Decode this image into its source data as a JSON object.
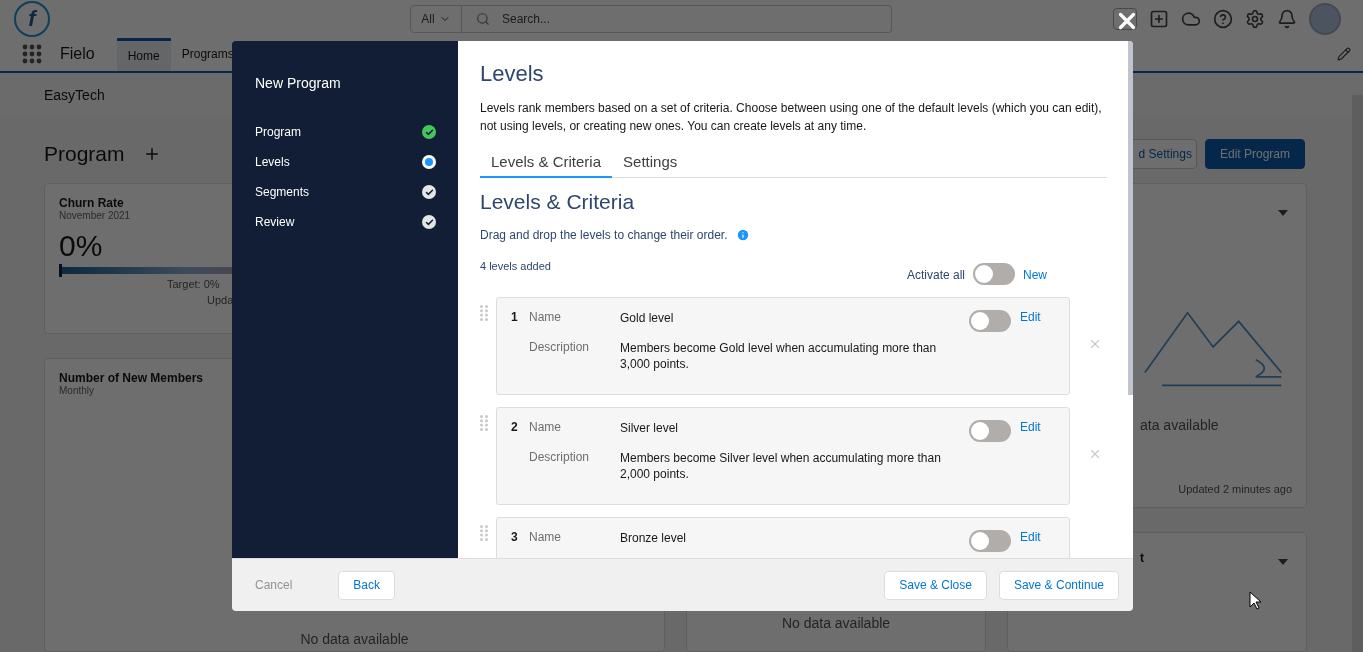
{
  "header": {
    "logo_text": "f",
    "search_scope": "All",
    "search_placeholder": "Search..."
  },
  "nav": {
    "app_name": "Fielo",
    "tabs": [
      {
        "label": "Home",
        "selected": true
      },
      {
        "label": "Programs",
        "selected": false
      }
    ]
  },
  "breadcrumb": "EasyTech",
  "page": {
    "title": "Program",
    "buttons": [
      {
        "label": "d Settings",
        "kind": "neutral"
      },
      {
        "label": "Edit Program",
        "kind": "brand"
      }
    ]
  },
  "cards": {
    "churn": {
      "title": "Churn Rate",
      "subtitle": "November 2021",
      "value": "0%",
      "level": 0,
      "target": "Target: 0%",
      "footer": "Upda"
    },
    "members": {
      "title": "Number of New Members",
      "subtitle": "Monthly",
      "empty": "No data available"
    },
    "middle": {
      "empty": "No data available"
    },
    "right_top": {
      "empty": "ata available",
      "footer": "Updated 2 minutes ago"
    },
    "right_bottom": {
      "title": "t"
    }
  },
  "modal": {
    "sidebar": {
      "title": "New Program",
      "steps": [
        {
          "label": "Program",
          "selected": false,
          "color": "#45c65a"
        },
        {
          "label": "Levels",
          "selected": true,
          "color": "#1b96ff"
        },
        {
          "label": "Segments",
          "selected": false,
          "color": "#e5e5e5"
        },
        {
          "label": "Review",
          "selected": false,
          "color": "#e5e5e5"
        }
      ]
    },
    "title": "Levels",
    "intro": "Levels rank members based on a set of criteria. Choose between using one of the default levels (which you can edit), not using levels, or creating new ones. You can create levels at any time.",
    "tabs": [
      {
        "label": "Levels & Criteria",
        "selected": true
      },
      {
        "label": "Settings",
        "selected": false
      }
    ],
    "section_title": "Levels & Criteria",
    "hint": "Drag and drop the levels to change their order.",
    "count": "4 levels added",
    "activate_all": {
      "label": "Activate all",
      "on": false
    },
    "new_link": "New",
    "levels": [
      {
        "number": "1",
        "name_label": "Name",
        "name": "Gold level",
        "description_label": "Description",
        "description": "Members become Gold level when accumulating more than 3,000 points.",
        "on": false,
        "edit": "Edit"
      },
      {
        "number": "2",
        "name_label": "Name",
        "name": "Silver level",
        "description_label": "Description",
        "description": "Members become Silver level when accumulating more than 2,000 points.",
        "on": false,
        "edit": "Edit"
      },
      {
        "number": "3",
        "name_label": "Name",
        "name": "Bronze level",
        "on": false,
        "edit": "Edit"
      }
    ],
    "footer": {
      "cancel": "Cancel",
      "back": "Back",
      "save_close": "Save & Close",
      "save_continue": "Save & Continue"
    }
  }
}
